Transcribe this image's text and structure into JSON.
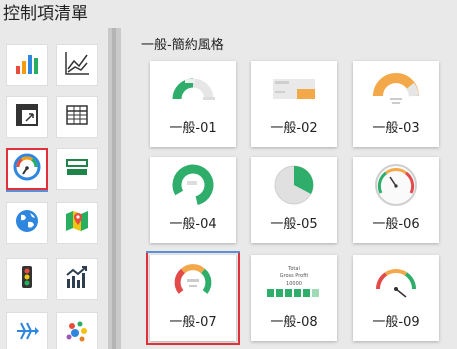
{
  "header": {
    "title": "控制項清單"
  },
  "sidebar": {
    "categories": [
      {
        "icon": "bar-chart-icon"
      },
      {
        "icon": "line-chart-icon"
      },
      {
        "icon": "pivot-table-icon"
      },
      {
        "icon": "table-grid-icon"
      },
      {
        "icon": "gauge-icon",
        "selected": true
      },
      {
        "icon": "list-bars-icon"
      },
      {
        "icon": "globe-icon"
      },
      {
        "icon": "map-icon"
      },
      {
        "icon": "traffic-light-icon"
      },
      {
        "icon": "trend-chart-icon"
      },
      {
        "icon": "fishbone-icon"
      },
      {
        "icon": "bubble-cluster-icon"
      }
    ]
  },
  "main": {
    "section_title": "一般-簡約風格",
    "items": [
      {
        "label": "一般-01"
      },
      {
        "label": "一般-02"
      },
      {
        "label": "一般-03"
      },
      {
        "label": "一般-04"
      },
      {
        "label": "一般-05"
      },
      {
        "label": "一般-06"
      },
      {
        "label": "一般-07",
        "selected": true
      },
      {
        "label": "一般-08",
        "thumb_title": "Total",
        "thumb_subtitle": "Gross Profit",
        "thumb_value": "10000"
      },
      {
        "label": "一般-09"
      }
    ]
  },
  "colors": {
    "selected_border": "#e0303a",
    "selected_underline": "#5b8fd8",
    "gauge_green": "#2fae6b",
    "gauge_orange": "#f3a84a",
    "gauge_red": "#e34b4b"
  }
}
